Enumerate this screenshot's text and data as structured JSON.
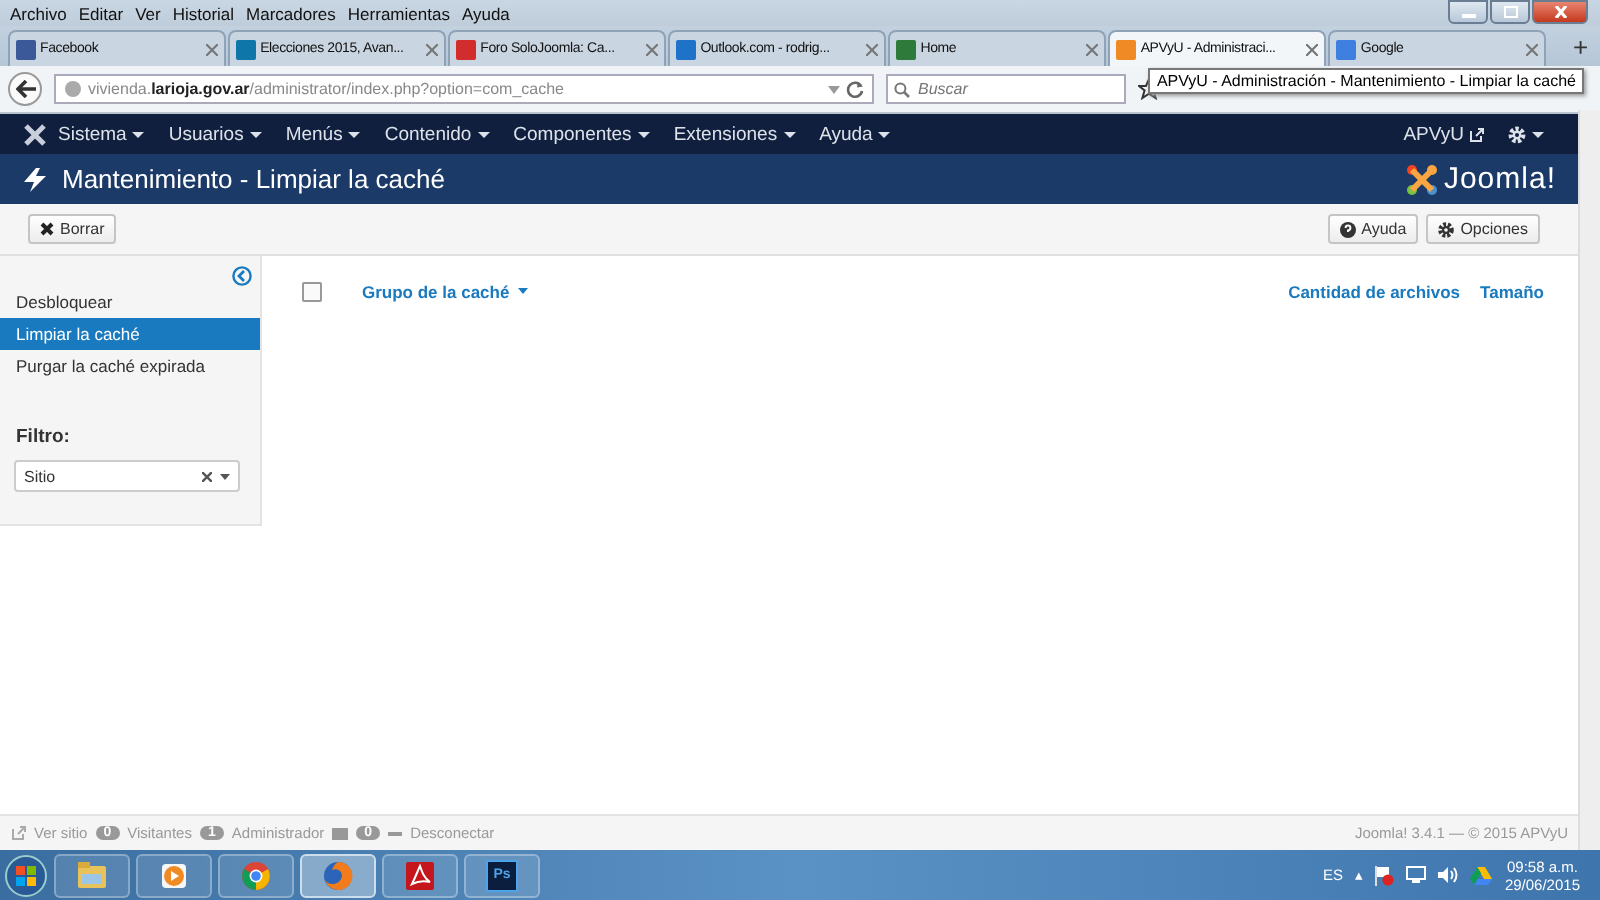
{
  "browser": {
    "menu": [
      "Archivo",
      "Editar",
      "Ver",
      "Historial",
      "Marcadores",
      "Herramientas",
      "Ayuda"
    ],
    "tabs": [
      {
        "label": "Facebook",
        "color": "#3b5998",
        "selected": false
      },
      {
        "label": "Elecciones 2015, Avan...",
        "color": "#0e76a8",
        "selected": false
      },
      {
        "label": "Foro SoloJoomla: Ca...",
        "color": "#d22d2d",
        "selected": false
      },
      {
        "label": "Outlook.com - rodrig...",
        "color": "#1e73c8",
        "selected": false
      },
      {
        "label": "Home",
        "color": "#2d7a3a",
        "selected": false
      },
      {
        "label": "APVyU - Administraci...",
        "color": "#f08a24",
        "selected": true
      },
      {
        "label": "Google",
        "color": "#3f7fe0",
        "selected": false
      }
    ],
    "new_tab": "+",
    "url": "vivienda.**larioja.gov.ar**/administrator/index.php?option=com_cache",
    "search": {
      "placeholder": "Buscar"
    },
    "tooltip": "APVyU - Administración - Mantenimiento - Limpiar la caché"
  },
  "joomla": {
    "nav": [
      "Sistema",
      "Usuarios",
      "Menús",
      "Contenido",
      "Componentes",
      "Extensiones",
      "Ayuda"
    ],
    "user": "APVyU",
    "title": "Mantenimiento - Limpiar la caché",
    "logo": "Joomla!",
    "toolbar": {
      "left": [
        "Borrar"
      ],
      "right": [
        "Ayuda",
        "Opciones"
      ]
    },
    "sidebar": {
      "items": [
        {
          "label": "Desbloquear",
          "selected": false
        },
        {
          "label": "Limpiar la caché",
          "selected": true
        },
        {
          "label": "Purgar la caché expirada",
          "selected": false
        }
      ],
      "filter_label": "Filtro:",
      "filter_value": "Sitio"
    },
    "table": {
      "select_all": {
        "checked": false
      },
      "columns": [
        "Grupo de la caché",
        "Cantidad de archivos",
        "Tamaño"
      ]
    },
    "status": {
      "view_site": "Ver sitio",
      "visitors_count": "0",
      "visitors": "Visitantes",
      "admins_count": "1",
      "admins": "Administrador",
      "messages_count": "0",
      "logout": "Desconectar",
      "version": "Joomla! 3.4.1 — © 2015 APVyU"
    }
  },
  "taskbar": {
    "apps": [
      {
        "kind": "folder",
        "selected": false
      },
      {
        "kind": "media",
        "selected": false
      },
      {
        "kind": "chrome",
        "selected": false
      },
      {
        "kind": "firefox",
        "selected": true
      },
      {
        "kind": "acrobat",
        "selected": false
      },
      {
        "kind": "photoshop",
        "label": "Ps",
        "selected": false
      }
    ],
    "language": "ES",
    "tray_arrow": "▴",
    "time": "09:58 a.m.",
    "date": "29/06/2015"
  }
}
